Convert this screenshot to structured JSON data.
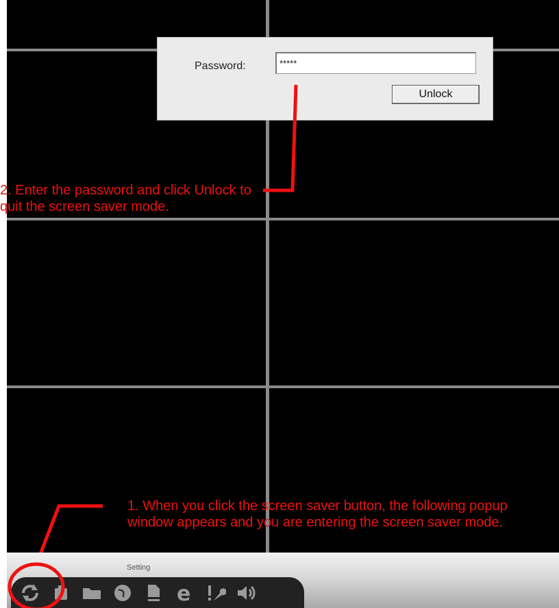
{
  "dialog": {
    "password_label": "Password:",
    "password_value": "*****",
    "unlock_label": "Unlock"
  },
  "annotations": {
    "step2": "2. Enter the password and click Unlock to quit the screen saver mode.",
    "step1": "1. When you click the screen saver button, the following popup window appears and you are entering the screen saver mode."
  },
  "taskbar": {
    "hover_label": "Setting",
    "icons": [
      "screen-saver-icon",
      "snapshot-icon",
      "folder-icon",
      "globe-icon",
      "document-icon",
      "browser-icon",
      "settings-icon",
      "volume-icon"
    ]
  },
  "colors": {
    "annotation": "#ee1111",
    "video_background": "#000000",
    "grid_line": "#8a8a8a"
  }
}
